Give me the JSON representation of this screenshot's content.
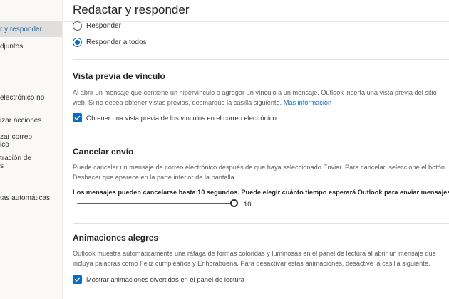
{
  "sidebar": {
    "items": [
      {
        "label": "r y responder",
        "active": true
      },
      {
        "label": "djuntos"
      },
      {
        "label": "electrónico no"
      },
      {
        "label": "izar acciones"
      },
      {
        "label": "zar correo"
      },
      {
        "label": "ico"
      },
      {
        "label": "tración de"
      },
      {
        "label": "s"
      },
      {
        "label": "tas automáticas"
      }
    ]
  },
  "header": {
    "title": "Redactar y responder"
  },
  "reply": {
    "options": [
      {
        "label": "Responder",
        "checked": false
      },
      {
        "label": "Responder a todos",
        "checked": true
      }
    ]
  },
  "link_preview": {
    "title": "Vista previa de vínculo",
    "desc_line1": "Al abrir un mensaje que contiene un hipervínculo o agregar un vínculo a un mensaje, Outlook inserta una vista previa del sitio",
    "desc_line2": "web. Si no desea obtener vistas previas, desmarque la casilla siguiente. ",
    "link": "Más información",
    "checkbox_label": "Obtener una vista previa de los vínculos en el correo electrónico",
    "checked": true
  },
  "undo_send": {
    "title": "Cancelar envío",
    "desc_line1": "Puede cancelar un mensaje de correo electrónico después de que haya seleccionado Enviar. Para cancelar, seleccione el botón",
    "desc_line2": "Deshacer que aparece en la parte inferior de la pantalla.",
    "bold_note": "Los mensajes pueden cancelarse hasta 10 segundos. Puede elegir cuánto tiempo esperará Outlook para enviar mensajes.",
    "slider_value": "10",
    "slider_max": 10
  },
  "animations": {
    "title": "Animaciones alegres",
    "desc_line1": "Outlook muestra automáticamente una ráfaga de formas coloridas y luminosas en el panel de lectura al abrir un mensaje que",
    "desc_line2": "incluya palabras como Feliz cumpleaños y Enhorabuena. Para desactivar estas animaciones, desactive la casilla siguiente.",
    "checkbox_label": "Mostrar animaciones divertidas en el panel de lectura",
    "checked": true
  },
  "colors": {
    "accent": "#0f6cbd",
    "text": "#252423",
    "muted": "#605e5c"
  }
}
